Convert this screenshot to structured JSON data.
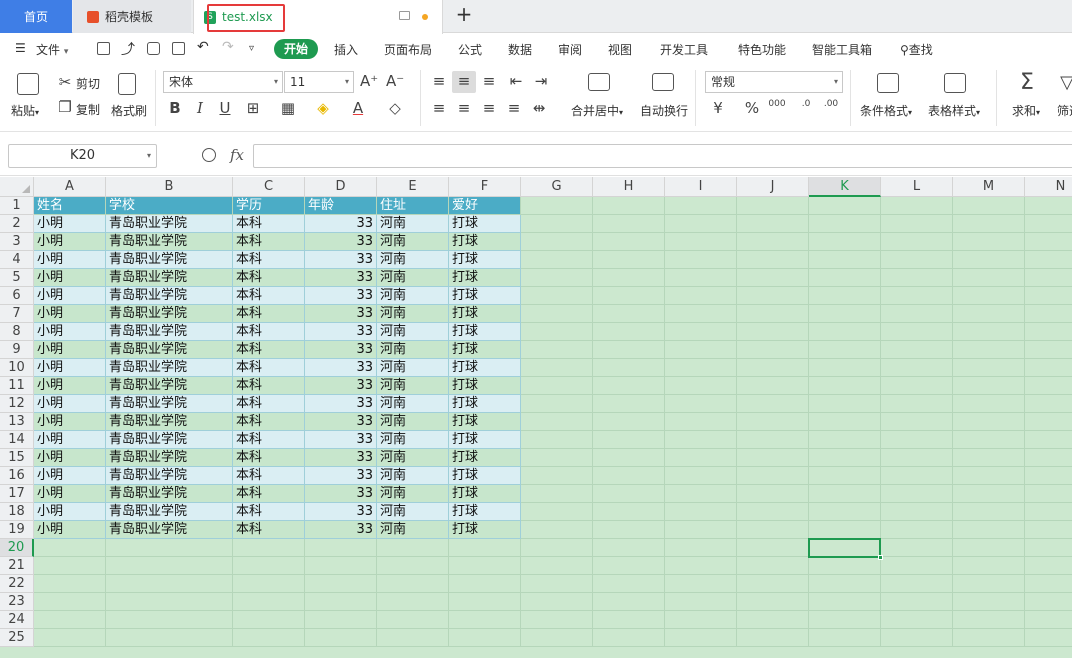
{
  "tabs": {
    "home": "首页",
    "template": "稻壳模板",
    "file": "test.xlsx",
    "file_icon_letter": "S"
  },
  "menu": {
    "file": "文件",
    "items": [
      "开始",
      "插入",
      "页面布局",
      "公式",
      "数据",
      "审阅",
      "视图",
      "开发工具",
      "特色功能",
      "智能工具箱",
      "查找"
    ]
  },
  "ribbon": {
    "paste": "粘贴",
    "cut": "剪切",
    "copy": "复制",
    "format_painter": "格式刷",
    "font_name": "宋体",
    "font_size": "11",
    "merge_center": "合并居中",
    "wrap_text": "自动换行",
    "number_format": "常规",
    "conditional_format": "条件格式",
    "table_style": "表格样式",
    "sum": "求和",
    "filter": "筛选"
  },
  "formula_bar": {
    "name_box": "K20",
    "fx": "fx",
    "value": ""
  },
  "sheet": {
    "columns": [
      "A",
      "B",
      "C",
      "D",
      "E",
      "F",
      "G",
      "H",
      "I",
      "J",
      "K",
      "L",
      "M",
      "N"
    ],
    "active_column": "K",
    "active_row": 20,
    "row_count": 25,
    "header": [
      "姓名",
      "学校",
      "学历",
      "年龄",
      "住址",
      "爱好"
    ],
    "rows": [
      [
        "小明",
        "青岛职业学院",
        "本科",
        "33",
        "河南",
        "打球"
      ],
      [
        "小明",
        "青岛职业学院",
        "本科",
        "33",
        "河南",
        "打球"
      ],
      [
        "小明",
        "青岛职业学院",
        "本科",
        "33",
        "河南",
        "打球"
      ],
      [
        "小明",
        "青岛职业学院",
        "本科",
        "33",
        "河南",
        "打球"
      ],
      [
        "小明",
        "青岛职业学院",
        "本科",
        "33",
        "河南",
        "打球"
      ],
      [
        "小明",
        "青岛职业学院",
        "本科",
        "33",
        "河南",
        "打球"
      ],
      [
        "小明",
        "青岛职业学院",
        "本科",
        "33",
        "河南",
        "打球"
      ],
      [
        "小明",
        "青岛职业学院",
        "本科",
        "33",
        "河南",
        "打球"
      ],
      [
        "小明",
        "青岛职业学院",
        "本科",
        "33",
        "河南",
        "打球"
      ],
      [
        "小明",
        "青岛职业学院",
        "本科",
        "33",
        "河南",
        "打球"
      ],
      [
        "小明",
        "青岛职业学院",
        "本科",
        "33",
        "河南",
        "打球"
      ],
      [
        "小明",
        "青岛职业学院",
        "本科",
        "33",
        "河南",
        "打球"
      ],
      [
        "小明",
        "青岛职业学院",
        "本科",
        "33",
        "河南",
        "打球"
      ],
      [
        "小明",
        "青岛职业学院",
        "本科",
        "33",
        "河南",
        "打球"
      ],
      [
        "小明",
        "青岛职业学院",
        "本科",
        "33",
        "河南",
        "打球"
      ],
      [
        "小明",
        "青岛职业学院",
        "本科",
        "33",
        "河南",
        "打球"
      ],
      [
        "小明",
        "青岛职业学院",
        "本科",
        "33",
        "河南",
        "打球"
      ],
      [
        "小明",
        "青岛职业学院",
        "本科",
        "33",
        "河南",
        "打球"
      ]
    ]
  },
  "colors": {
    "accent": "#1e9a50",
    "home_tab": "#3f7ee6",
    "sheet_bg": "#cce8cf",
    "table_header": "#4bacc6",
    "band_light": "#daeef3",
    "band_green": "#c7e6cc",
    "highlight": "#e53a3a"
  }
}
